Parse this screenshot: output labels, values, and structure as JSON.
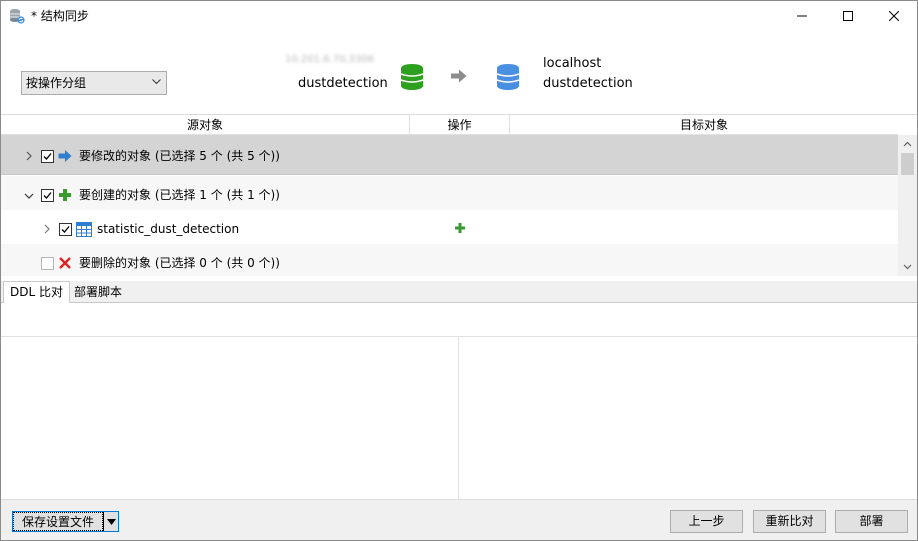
{
  "window": {
    "title": "* 结构同步",
    "icon": "database-sync-icon"
  },
  "header": {
    "group_select": {
      "value": "按操作分组"
    },
    "source": {
      "host": "10.201.6.70,3306",
      "database": "dustdetection"
    },
    "target": {
      "host": "localhost",
      "database": "dustdetection"
    },
    "colors": {
      "source_db": "#2ea01f",
      "target_db": "#4a90e2",
      "arrow": "#8c8c8c"
    }
  },
  "grid": {
    "columns": [
      "源对象",
      "操作",
      "目标对象"
    ],
    "rows": [
      {
        "label": "要修改的对象 (已选择 5 个 (共 5 个))",
        "icon": "arrow-right-icon",
        "checked": true,
        "expanded": false
      },
      {
        "label": "要创建的对象 (已选择 1 个 (共 1 个))",
        "icon": "plus-icon",
        "checked": true,
        "expanded": true
      },
      {
        "label": "statistic_dust_detection",
        "icon": "table-icon",
        "checked": true,
        "expanded": false,
        "operation_icon": "plus-icon"
      },
      {
        "label": "要删除的对象 (已选择 0 个 (共 0 个))",
        "icon": "cross-icon",
        "checked": false,
        "expanded": false
      }
    ]
  },
  "tabs": [
    {
      "label": "DDL 比对",
      "active": true
    },
    {
      "label": "部署脚本",
      "active": false
    }
  ],
  "footer": {
    "save_settings": "保存设置文件",
    "prev": "上一步",
    "recompare": "重新比对",
    "deploy": "部署"
  }
}
